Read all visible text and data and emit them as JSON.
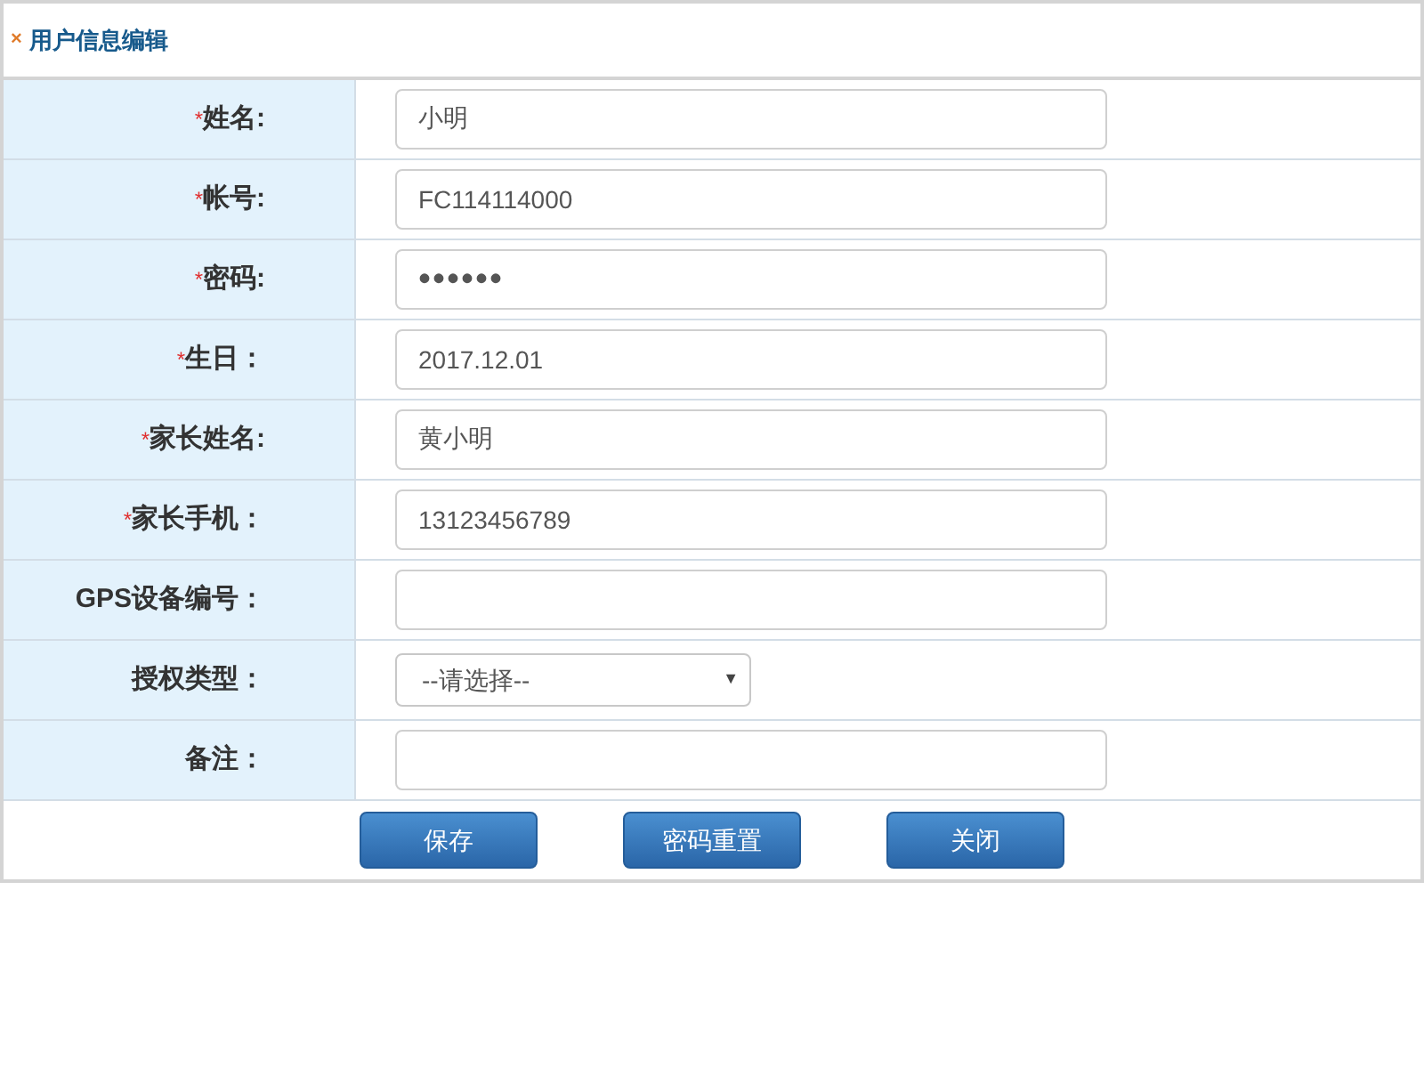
{
  "title": "用户信息编辑",
  "title_icon": "×",
  "required_mark": "*",
  "dropdown_arrow": "▼",
  "fields": [
    {
      "label": "姓名:",
      "required": true,
      "kind": "text",
      "value": "小明"
    },
    {
      "label": "帐号:",
      "required": true,
      "kind": "text",
      "value": "FC114114000"
    },
    {
      "label": "密码:",
      "required": true,
      "kind": "password",
      "value": "••••••"
    },
    {
      "label": "生日：",
      "required": true,
      "kind": "text",
      "value": "2017.12.01"
    },
    {
      "label": "家长姓名:",
      "required": true,
      "kind": "text",
      "value": "黄小明"
    },
    {
      "label": "家长手机：",
      "required": true,
      "kind": "text",
      "value": "13123456789"
    },
    {
      "label": "GPS设备编号：",
      "required": false,
      "kind": "text"
    },
    {
      "label": "授权类型：",
      "required": false,
      "kind": "select",
      "value": "--请选择--"
    },
    {
      "label": "备注：",
      "required": false,
      "kind": "text"
    }
  ],
  "buttons": [
    "保存",
    "密码重置",
    "关闭"
  ]
}
